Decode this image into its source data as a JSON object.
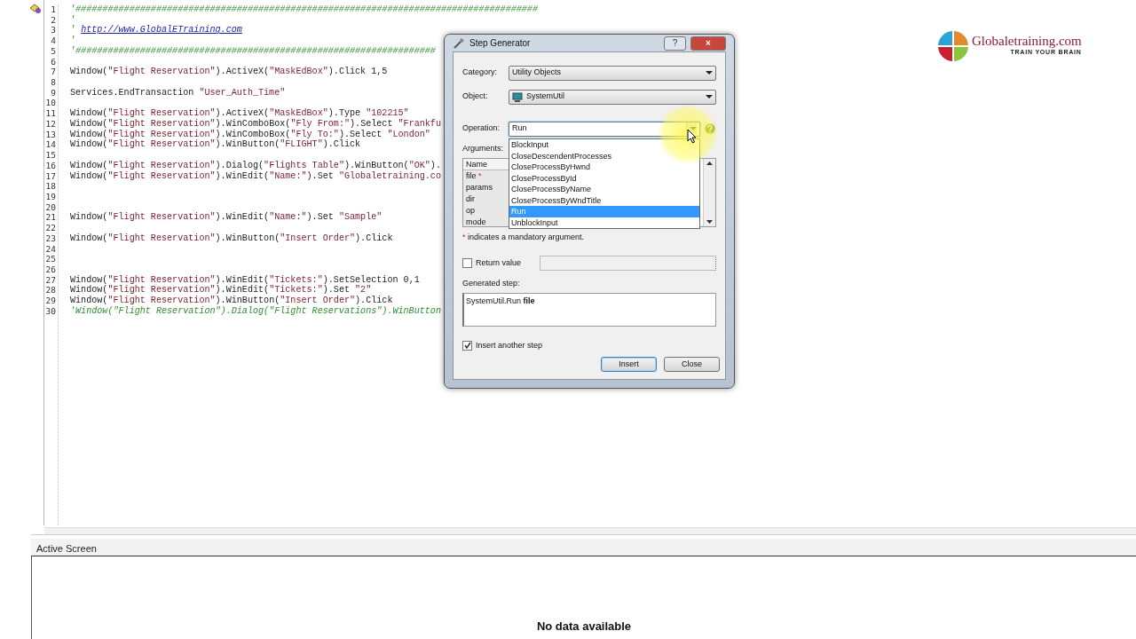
{
  "editor": {
    "lines": [
      {
        "number": "1",
        "kind": "comment",
        "text": "'######################################################################################"
      },
      {
        "number": "2",
        "kind": "comment",
        "text": "'"
      },
      {
        "number": "3",
        "kind": "link",
        "prefix": "'",
        "text": "http://www.GlobalETraining.com"
      },
      {
        "number": "4",
        "kind": "comment",
        "text": "'"
      },
      {
        "number": "5",
        "kind": "comment",
        "text": "'###################################################################"
      },
      {
        "number": "6",
        "kind": "blank"
      },
      {
        "number": "7",
        "kind": "code",
        "text": "Window(\"Flight Reservation\").ActiveX(\"MaskEdBox\").Click 1,5"
      },
      {
        "number": "8",
        "kind": "blank"
      },
      {
        "number": "9",
        "kind": "code",
        "text": "Services.EndTransaction \"User_Auth_Time\""
      },
      {
        "number": "10",
        "kind": "blank"
      },
      {
        "number": "11",
        "kind": "code",
        "text": "Window(\"Flight Reservation\").ActiveX(\"MaskEdBox\").Type \"102215\""
      },
      {
        "number": "12",
        "kind": "code",
        "text": "Window(\"Flight Reservation\").WinComboBox(\"Fly From:\").Select \"Frankfu"
      },
      {
        "number": "13",
        "kind": "code",
        "text": "Window(\"Flight Reservation\").WinComboBox(\"Fly To:\").Select \"London\""
      },
      {
        "number": "14",
        "kind": "code",
        "text": "Window(\"Flight Reservation\").WinButton(\"FLIGHT\").Click"
      },
      {
        "number": "15",
        "kind": "blank"
      },
      {
        "number": "16",
        "kind": "code",
        "text": "Window(\"Flight Reservation\").Dialog(\"Flights Table\").WinButton(\"OK\")."
      },
      {
        "number": "17",
        "kind": "code",
        "text": "Window(\"Flight Reservation\").WinEdit(\"Name:\").Set \"Globaletraining.co"
      },
      {
        "number": "18",
        "kind": "blank"
      },
      {
        "number": "19",
        "kind": "blank"
      },
      {
        "number": "20",
        "kind": "blank"
      },
      {
        "number": "21",
        "kind": "code",
        "text": "Window(\"Flight Reservation\").WinEdit(\"Name:\").Set \"Sample\""
      },
      {
        "number": "22",
        "kind": "blank"
      },
      {
        "number": "23",
        "kind": "code",
        "text": "Window(\"Flight Reservation\").WinButton(\"Insert Order\").Click"
      },
      {
        "number": "24",
        "kind": "blank"
      },
      {
        "number": "25",
        "kind": "blank"
      },
      {
        "number": "26",
        "kind": "blank"
      },
      {
        "number": "27",
        "kind": "code",
        "text": "Window(\"Flight Reservation\").WinEdit(\"Tickets:\").SetSelection 0,1"
      },
      {
        "number": "28",
        "kind": "code",
        "text": "Window(\"Flight Reservation\").WinEdit(\"Tickets:\").Set \"2\""
      },
      {
        "number": "29",
        "kind": "code",
        "text": "Window(\"Flight Reservation\").WinButton(\"Insert Order\").Click"
      },
      {
        "number": "30",
        "kind": "comment",
        "text": "'Window(\"Flight Reservation\").Dialog(\"Flight Reservations\").WinButton"
      }
    ]
  },
  "logo": {
    "name": "Globaletraining.com",
    "tagline": "TRAIN YOUR BRAIN"
  },
  "dialog": {
    "title": "Step Generator",
    "help_button": "?",
    "close_button": "×",
    "category": {
      "label": "Category:",
      "value": "Utility Objects"
    },
    "object": {
      "label": "Object:",
      "value": "SystemUtil"
    },
    "operation": {
      "label": "Operation:",
      "value": "Run",
      "expanded": true,
      "options": [
        {
          "label": "BlockInput",
          "selected": false
        },
        {
          "label": "CloseDescendentProcesses",
          "selected": false
        },
        {
          "label": "CloseProcessByHwnd",
          "selected": false
        },
        {
          "label": "CloseProcessById",
          "selected": false
        },
        {
          "label": "CloseProcessByName",
          "selected": false
        },
        {
          "label": "CloseProcessByWndTitle",
          "selected": false
        },
        {
          "label": "Run",
          "selected": true
        },
        {
          "label": "UnblockInput",
          "selected": false
        }
      ]
    },
    "arguments": {
      "label": "Arguments:",
      "column": "Name",
      "rows": [
        {
          "name": "file",
          "mandatory": true
        },
        {
          "name": "params",
          "mandatory": false
        },
        {
          "name": "dir",
          "mandatory": false
        },
        {
          "name": "op",
          "mandatory": false
        },
        {
          "name": "mode",
          "mandatory": false
        }
      ]
    },
    "note_marker": "*",
    "note": "indicates a mandatory argument.",
    "return_value": {
      "label": "Return value",
      "checked": false
    },
    "generated_step": {
      "label": "Generated step:",
      "value": "SystemUtil.Run **file**"
    },
    "insert_another": {
      "label": "Insert another step",
      "checked": true
    },
    "buttons": [
      {
        "label": "Insert",
        "default": true
      },
      {
        "label": "Close",
        "default": false
      }
    ]
  },
  "active_screen": {
    "title": "Active Screen",
    "message": "No data available"
  }
}
